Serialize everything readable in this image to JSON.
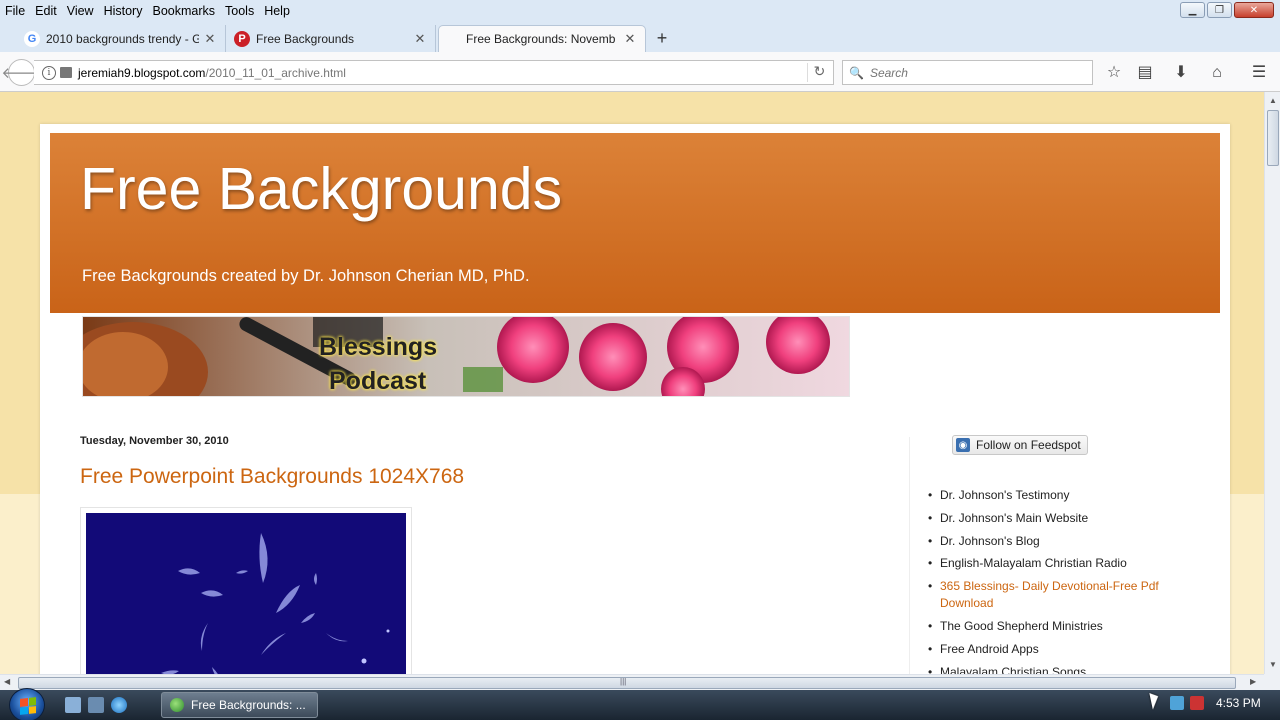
{
  "menu": {
    "items": [
      "File",
      "Edit",
      "View",
      "History",
      "Bookmarks",
      "Tools",
      "Help"
    ]
  },
  "tabs": [
    {
      "label": "2010 backgrounds trendy - G",
      "favicon": "google-icon",
      "active": false
    },
    {
      "label": "Free Backgrounds",
      "favicon": "pinterest-icon",
      "active": false
    },
    {
      "label": "Free Backgrounds: Novemb",
      "favicon": "none",
      "active": true
    }
  ],
  "navbar": {
    "url_host": "jeremiah9.blogspot.com",
    "url_path": "/2010_11_01_archive.html",
    "search_placeholder": "Search"
  },
  "blog": {
    "title": "Free Backgrounds",
    "description": "Free Backgrounds created by Dr. Johnson Cherian MD, PhD.",
    "banner_text_line1": "Blessings",
    "banner_text_line2": "Podcast",
    "post_date": "Tuesday, November 30, 2010",
    "post_title": "Free Powerpoint Backgrounds 1024X768"
  },
  "sidebar": {
    "feedspot_label": "Follow on Feedspot",
    "links": [
      {
        "label": "Dr. Johnson's Testimony",
        "highlight": false
      },
      {
        "label": "Dr. Johnson's Main Website",
        "highlight": false
      },
      {
        "label": "Dr. Johnson's Blog",
        "highlight": false
      },
      {
        "label": "English-Malayalam Christian Radio",
        "highlight": false
      },
      {
        "label": "365 Blessings- Daily Devotional-Free Pdf Download",
        "highlight": true
      },
      {
        "label": "The Good Shepherd Ministries",
        "highlight": false
      },
      {
        "label": "Free Android Apps",
        "highlight": false
      },
      {
        "label": "Malayalam Christian Songs",
        "highlight": false
      }
    ]
  },
  "taskbar": {
    "task_label": "Free Backgrounds: ...",
    "clock": "4:53 PM"
  },
  "colors": {
    "header_orange": "#c96318",
    "link_orange": "#cc6611",
    "page_background": "#f6e2a8",
    "post_image_blue": "#120a78"
  }
}
